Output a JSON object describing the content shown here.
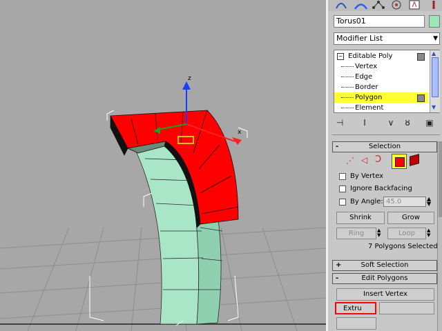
{
  "object_name": "Torus01",
  "object_color": "#9fe6b5",
  "modifier_list": {
    "label": "Modifier List"
  },
  "stack": {
    "items": [
      {
        "label": "Editable Poly",
        "level": 0,
        "selected": false
      },
      {
        "label": "Vertex",
        "level": 1,
        "selected": false
      },
      {
        "label": "Edge",
        "level": 1,
        "selected": false
      },
      {
        "label": "Border",
        "level": 1,
        "selected": false
      },
      {
        "label": "Polygon",
        "level": 1,
        "selected": true
      },
      {
        "label": "Element",
        "level": 1,
        "selected": false
      }
    ]
  },
  "selection": {
    "title": "Selection",
    "by_vertex": "By Vertex",
    "ignore_backfacing": "Ignore Backfacing",
    "by_angle": "By Angle:",
    "angle_value": "45.0",
    "shrink": "Shrink",
    "grow": "Grow",
    "ring": "Ring",
    "loop": "Loop",
    "status": "7 Polygons Selected"
  },
  "soft_selection": {
    "title": "Soft Selection",
    "sign": "+"
  },
  "edit_polygons": {
    "title": "Edit Polygons",
    "sign": "-",
    "insert_vertex": "Insert Vertex",
    "extrude": "Extru"
  },
  "selection_sign": "-",
  "viewport": {
    "axis_labels": {
      "z": "z",
      "x": "x"
    }
  },
  "colors": {
    "selected_face": "#ff0000",
    "object_face": "#a9e6c8",
    "highlight": "#ffff33"
  }
}
